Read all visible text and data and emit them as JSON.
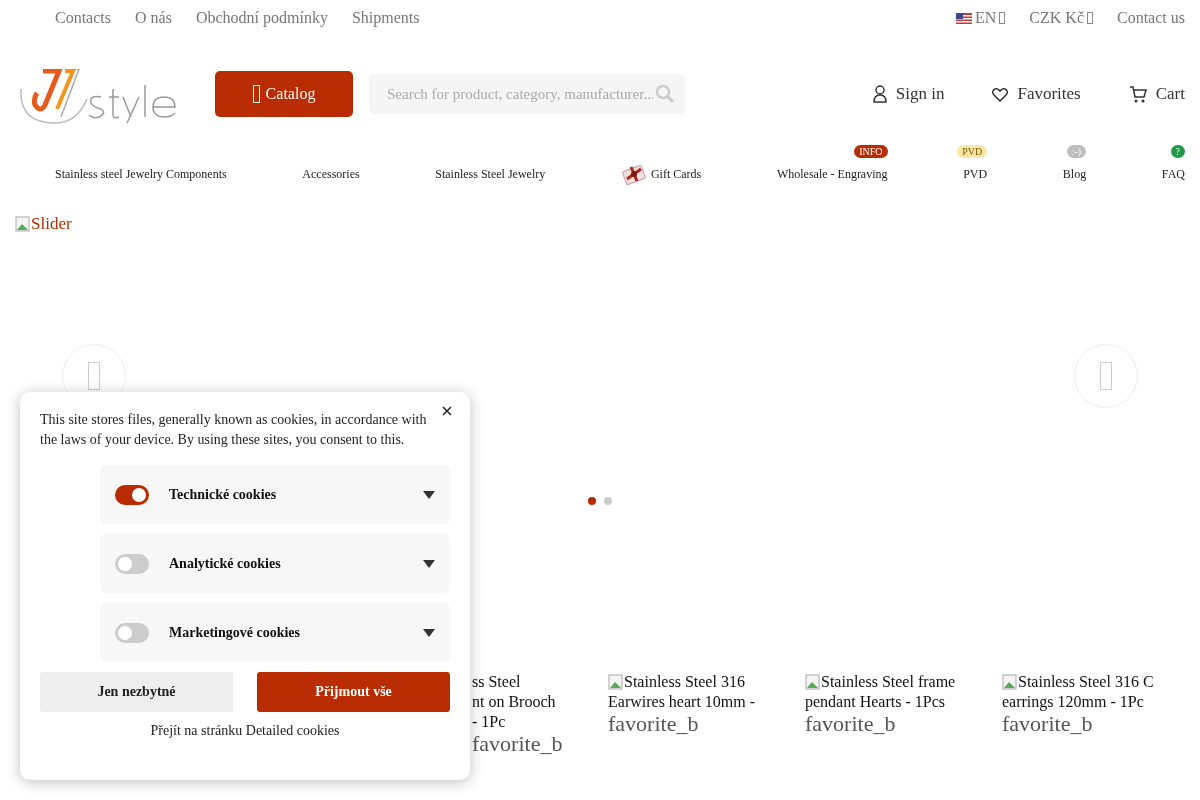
{
  "top_links": [
    "Contacts",
    "O nás",
    "Obchodní podmínky",
    "Shipments"
  ],
  "top_right": {
    "language": "EN",
    "currency": "CZK Kč",
    "contact": "Contact us"
  },
  "header": {
    "catalog": "Catalog",
    "search": {
      "placeholder": "Search for product, category, manufacturer..."
    },
    "actions": [
      {
        "kind": "user",
        "label": "Sign in"
      },
      {
        "kind": "heart",
        "label": "Favorites"
      },
      {
        "kind": "cart",
        "label": "Cart"
      }
    ]
  },
  "nav": [
    {
      "label": "Stainless steel Jewelry Components"
    },
    {
      "label": "Accessories"
    },
    {
      "label": "Stainless Steel Jewelry"
    },
    {
      "label": "Gift Cards",
      "kind": "gift"
    },
    {
      "label": "Wholesale - Engraving",
      "badge": "INFO",
      "color": "#b92b00"
    },
    {
      "label": "PVD",
      "badge": "PVD",
      "color": "#fde7a6"
    },
    {
      "label": "Blog",
      "badge": ":-)",
      "color": "#bdbdbd"
    },
    {
      "label": "FAQ",
      "badge": "?",
      "color": "#1f9a4a"
    }
  ],
  "slider": {
    "alt": "Slider",
    "dots": [
      {
        "selected": true
      },
      {
        "selected": false
      }
    ]
  },
  "products": [
    {
      "lines": [
        "ss Steel",
        "nt on Brooch",
        "- 1Pc"
      ],
      "favorite": "favorite_b"
    },
    {
      "lines": [
        "Stainless Steel 316",
        "Earwires heart 10mm -"
      ],
      "favorite": "favorite_b",
      "broken_image": true
    },
    {
      "lines": [
        "Stainless Steel frame",
        "pendant Hearts - 1Pcs"
      ],
      "favorite": "favorite_b",
      "broken_image": true
    },
    {
      "lines": [
        "Stainless Steel 316 C",
        "earrings 120mm - 1Pc"
      ],
      "favorite": "favorite_b",
      "broken_image": true
    }
  ],
  "cookie_dialog": {
    "text": "This site stores files, generally known as cookies, in accordance with the laws of your device. By using these sites, you consent to this.",
    "categories": [
      {
        "label": "Technické cookies",
        "on": true
      },
      {
        "label": "Analytické cookies",
        "on": false
      },
      {
        "label": "Marketingové cookies",
        "on": false
      }
    ],
    "buttons": [
      {
        "label": "Jen nezbytné",
        "kind": "secondary"
      },
      {
        "label": "Přijmout vše",
        "kind": "primary"
      }
    ],
    "link": "Přejít na stránku Detailed cookies"
  }
}
